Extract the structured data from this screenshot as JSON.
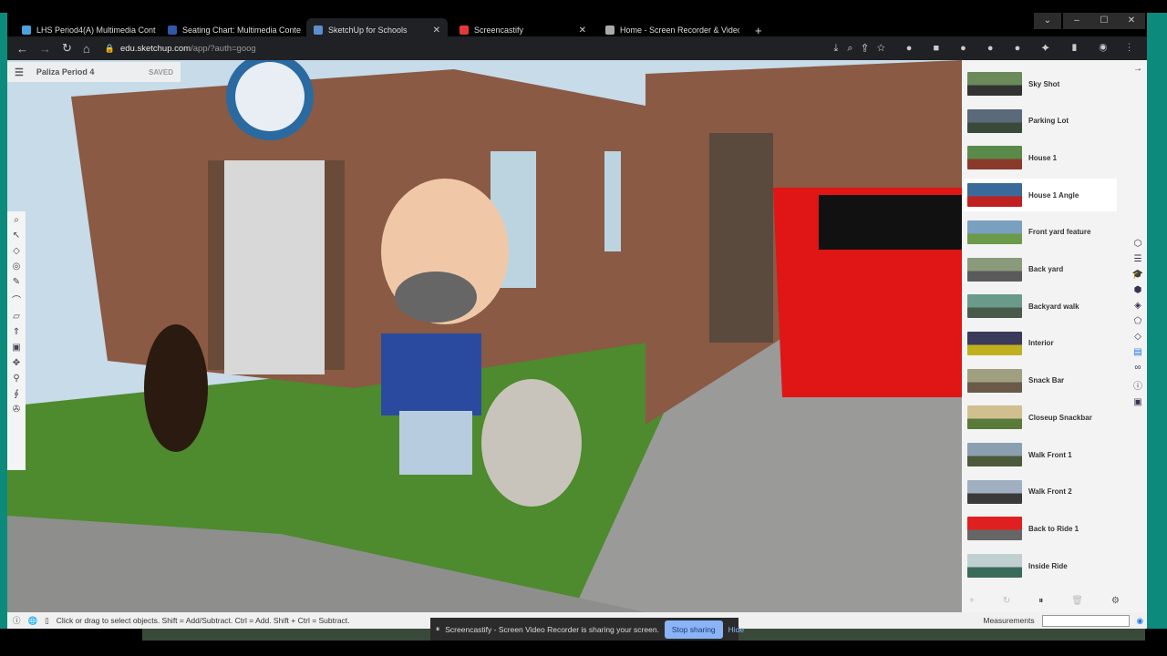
{
  "browser": {
    "tabs": [
      {
        "label": "LHS Period4(A) Multimedia Cont",
        "color": "#4aa3df"
      },
      {
        "label": "Seating Chart: Multimedia Conte",
        "color": "#3355aa"
      },
      {
        "label": "SketchUp for Schools",
        "color": "#5b8fd0",
        "active": true
      },
      {
        "label": "Screencastify",
        "color": "#e53935"
      },
      {
        "label": "Home - Screen Recorder & Videc",
        "color": "#aaaaaa"
      }
    ],
    "new_tab": "+",
    "url_host": "edu.sketchup.com",
    "url_path": "/app/?auth=goog"
  },
  "app": {
    "model_name": "Paliza Period 4",
    "save_status": "SAVED",
    "scenes": [
      "Sky Shot",
      "Parking Lot",
      "House 1",
      "House 1 Angle",
      "Front yard feature",
      "Back yard",
      "Backyard walk",
      "Interior",
      "Snack Bar",
      "Closeup Snackbar",
      "Walk Front 1",
      "Walk Front 2",
      "Back to Ride 1",
      "Inside Ride"
    ],
    "selected_scene": "House 1 Angle",
    "status_text": "Click or drag to select objects. Shift = Add/Subtract. Ctrl = Add. Shift + Ctrl = Subtract.",
    "measurements_label": "Measurements",
    "measurements_value": ""
  },
  "share_bar": {
    "text": "Screencastify - Screen Video Recorder is sharing your screen.",
    "stop": "Stop sharing",
    "hide": "Hide"
  }
}
